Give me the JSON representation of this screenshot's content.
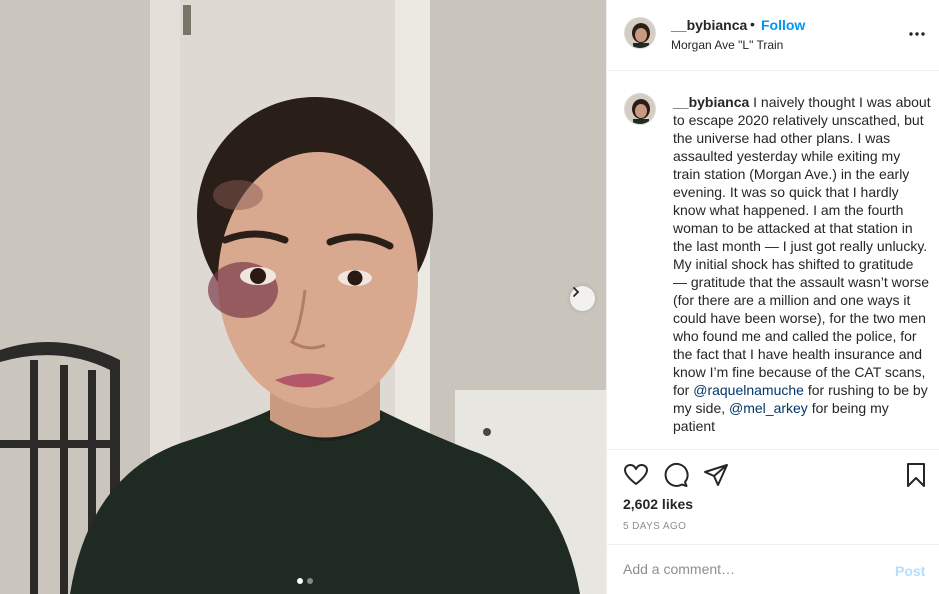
{
  "header": {
    "username": "__bybianca",
    "bullet": "•",
    "follow_label": "Follow",
    "location": "Morgan Ave \"L\" Train",
    "more_icon": "more-horizontal-icon"
  },
  "caption": {
    "username": "__bybianca",
    "para1": " I naively thought I was about to escape 2020 relatively unscathed, but the universe had other plans. I was assaulted yesterday while exiting my train station (Morgan Ave.) in the early evening. It was so quick that I hardly know what happened. I am the fourth woman to be attacked at that station in the last month — I just got really unlucky.",
    "para2_before": "My initial shock has shifted to gratitude — gratitude that the assault wasn’t worse (for there are a million and one ways it could have been worse), for the two men who found me and called the police, for the fact that I have health insurance and know I’m fine because of the CAT scans, for ",
    "mention1": "@raquelnamuche",
    "para2_mid": " for rushing to be by my side, ",
    "mention2": "@mel_arkey",
    "para2_after": " for being my patient"
  },
  "actions": {
    "like_icon": "heart-icon",
    "comment_icon": "comment-icon",
    "share_icon": "share-icon",
    "save_icon": "bookmark-icon",
    "likes": "2,602 likes",
    "time": "5 DAYS AGO"
  },
  "comment": {
    "placeholder": "Add a comment…",
    "post_label": "Post"
  },
  "carousel": {
    "dots": 2,
    "active_index": 0,
    "next_icon": "chevron-right-icon"
  },
  "colors": {
    "link": "#0095f6",
    "mention": "#00376b",
    "muted": "#8e8e8e",
    "post_disabled": "#b2dffc"
  }
}
